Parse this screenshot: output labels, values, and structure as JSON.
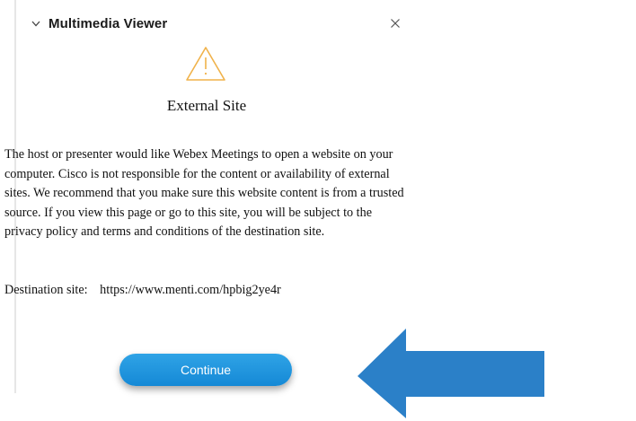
{
  "panel": {
    "title": "Multimedia Viewer"
  },
  "dialog": {
    "heading": "External Site",
    "message": "The host or presenter would like Webex Meetings to open a website on your computer. Cisco is not responsible for the content or availability of external sites. We recommend that you make sure this website content is from a trusted source. If you view this page or go to this site, you will be subject to the privacy policy and terms and conditions of the destination site.",
    "destination_label": "Destination site:",
    "destination_url": "https://www.menti.com/hpbig2ye4r",
    "continue_label": "Continue"
  },
  "icons": {
    "collapse": "chevron-down-icon",
    "close": "close-icon",
    "warning": "warning-triangle-icon",
    "annotation_arrow": "arrow-left-icon"
  },
  "colors": {
    "continue_button": "#1a93dd",
    "warning_icon": "#f0b24a",
    "annotation_arrow": "#2b80c8"
  }
}
